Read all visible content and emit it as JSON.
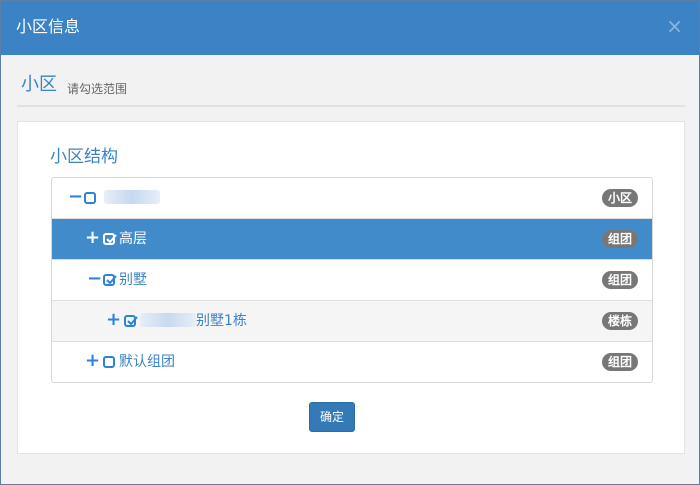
{
  "dialog": {
    "title": "小区信息",
    "close_glyph": "×"
  },
  "section": {
    "title": "小区",
    "subtitle": "请勾选范围"
  },
  "tree": {
    "title": "小区结构",
    "nodes": [
      {
        "toggle": "−",
        "checked": false,
        "label": "",
        "badge": "小区"
      },
      {
        "toggle": "+",
        "checked": true,
        "label": "高层",
        "badge": "组团"
      },
      {
        "toggle": "−",
        "checked": true,
        "label": "别墅",
        "badge": "组团"
      },
      {
        "toggle": "+",
        "checked": true,
        "label": "别墅1栋",
        "badge": "楼栋"
      },
      {
        "toggle": "+",
        "checked": false,
        "label": "默认组团",
        "badge": "组团"
      }
    ]
  },
  "footer": {
    "confirm_label": "确定"
  },
  "colors": {
    "header": "#3c83c5",
    "selected_row": "#428bca",
    "badge": "#777777",
    "button": "#337ab7"
  },
  "icons": {
    "expand": "plus-icon",
    "collapse": "minus-icon",
    "checked": "checkbox-checked-icon",
    "unchecked": "checkbox-unchecked-icon"
  }
}
